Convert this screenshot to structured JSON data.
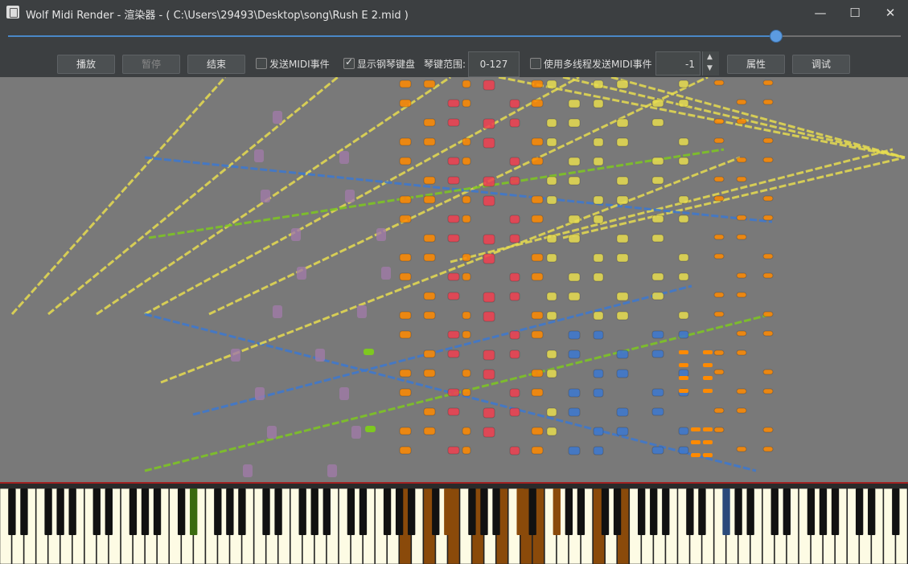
{
  "window": {
    "title": "Wolf Midi Render - 渲染器 - ( C:\\Users\\29493\\Desktop\\song\\Rush E 2.mid )",
    "minimize_glyph": "—",
    "maximize_glyph": "☐",
    "close_glyph": "✕"
  },
  "progress": {
    "fraction": 0.86
  },
  "toolbar": {
    "play_label": "播放",
    "pause_label": "暂停",
    "stop_label": "结束",
    "send_midi_label": "发送MIDI事件",
    "send_midi_checked": false,
    "show_piano_label": "显示钢琴键盘",
    "show_piano_checked": true,
    "key_range_label": "琴键范围:",
    "key_range_value": "0-127",
    "multithread_label": "使用多线程发送MIDI事件",
    "multithread_checked": false,
    "thread_value": "-1",
    "properties_label": "属性",
    "debug_label": "调试"
  },
  "colors": {
    "accent": "#4a88c7",
    "note_yellow": "#e6dc50",
    "note_orange": "#ff8a00",
    "note_red": "#f04050",
    "note_blue": "#3c78d0",
    "note_green": "#7ec820",
    "note_purple": "#a07aa8",
    "pressed_key": "#8a4a0a",
    "pressed_key_green": "#3a6a10",
    "pressed_key_blue": "#2a4a7a"
  }
}
